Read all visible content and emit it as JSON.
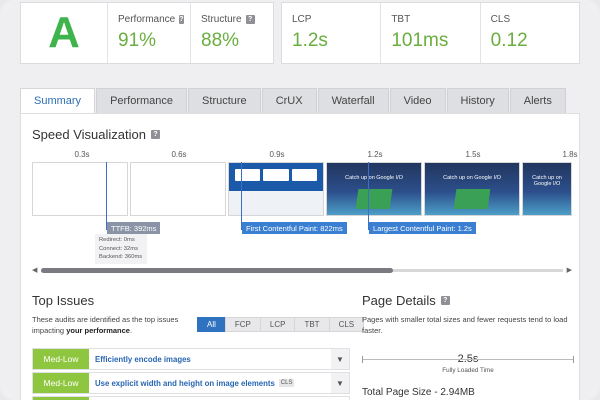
{
  "grade": {
    "letter": "A",
    "color": "#3fb44d"
  },
  "scores": [
    {
      "label": "Performance",
      "value": "91%"
    },
    {
      "label": "Structure",
      "value": "88%"
    }
  ],
  "web_vitals": [
    {
      "label": "LCP",
      "value": "1.2s"
    },
    {
      "label": "TBT",
      "value": "101ms"
    },
    {
      "label": "CLS",
      "value": "0.12"
    }
  ],
  "tabs": [
    "Summary",
    "Performance",
    "Structure",
    "CrUX",
    "Waterfall",
    "Video",
    "History",
    "Alerts"
  ],
  "active_tab": "Summary",
  "speed_visualization": {
    "title": "Speed Visualization",
    "timeline": [
      "0.3s",
      "0.6s",
      "0.9s",
      "1.2s",
      "1.5s",
      "1.8s"
    ],
    "frame_text": "Catch up on Google I/O",
    "ttfb_marker": "TTFB: 392ms",
    "ttfb_details": [
      "Redirect: 0ms",
      "Connect: 32ms",
      "Backend: 360ms"
    ],
    "fcp_marker": "First Contentful Paint: 822ms",
    "lcp_marker": "Largest Contentful Paint: 1.2s"
  },
  "top_issues": {
    "title": "Top Issues",
    "desc_start": "These audits are identified as the top issues impacting ",
    "desc_bold": "your performance",
    "desc_end": ".",
    "filters": [
      "All",
      "FCP",
      "LCP",
      "TBT",
      "CLS"
    ],
    "active_filter": "All",
    "issues": [
      {
        "severity": "Med-Low",
        "title": "Efficiently encode images",
        "tag": ""
      },
      {
        "severity": "Med-Low",
        "title": "Use explicit width and height on image elements",
        "tag": "CLS"
      }
    ]
  },
  "page_details": {
    "title": "Page Details",
    "desc": "Pages with smaller total sizes and fewer requests tend to load faster.",
    "fully_loaded_value": "2.5s",
    "fully_loaded_label": "Fully Loaded Time",
    "total_page_size": "Total Page Size - 2.94MB"
  },
  "colors": {
    "accent": "#2e72c0",
    "good": "#6aae3f",
    "severity_med_low": "#8fc63f"
  },
  "icons": [
    "help-icon",
    "chevron-down-icon",
    "scroll-left-icon",
    "scroll-right-icon"
  ]
}
